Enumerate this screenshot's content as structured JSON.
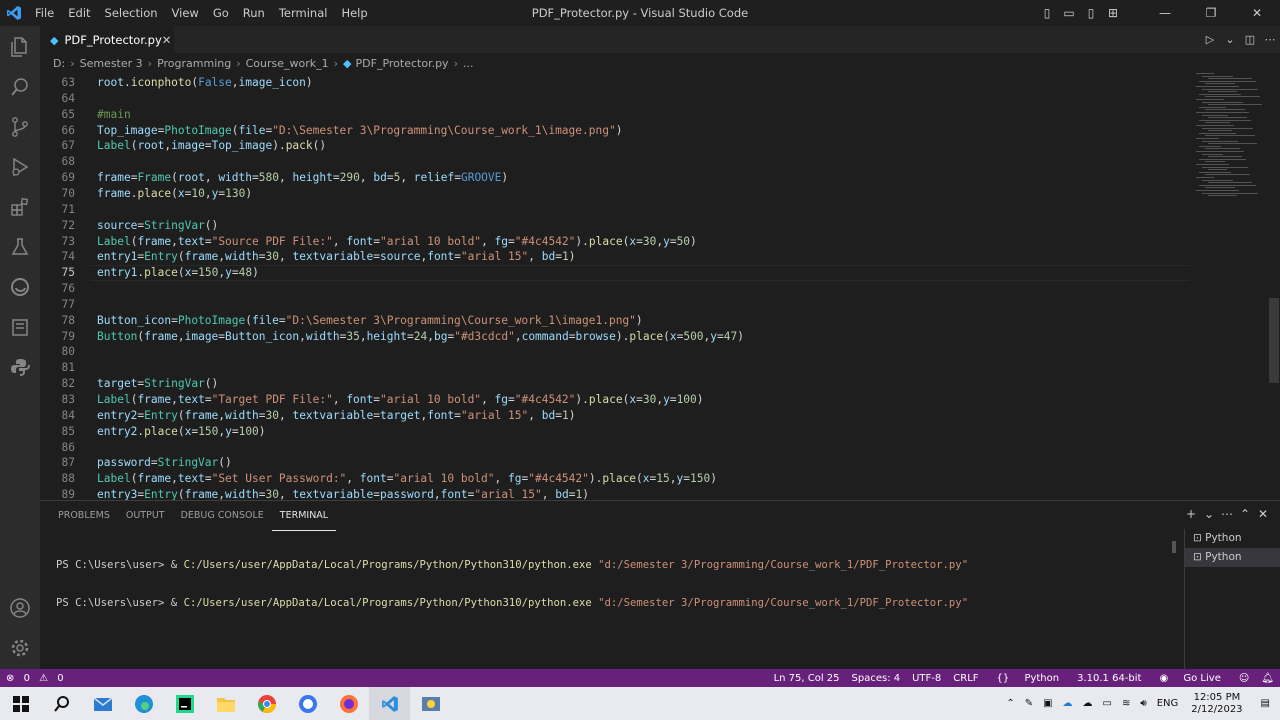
{
  "window": {
    "title": "PDF_Protector.py - Visual Studio Code",
    "menus": [
      "File",
      "Edit",
      "Selection",
      "View",
      "Go",
      "Run",
      "Terminal",
      "Help"
    ]
  },
  "tab": {
    "name": "PDF_Protector.py",
    "close": "✕"
  },
  "breadcrumb": [
    "D:",
    "Semester 3",
    "Programming",
    "Course_work_1",
    "PDF_Protector.py",
    "..."
  ],
  "editor": {
    "line_numbers": [
      "63",
      "64",
      "65",
      "66",
      "67",
      "68",
      "69",
      "70",
      "71",
      "72",
      "73",
      "74",
      "75",
      "76",
      "77",
      "78",
      "79",
      "80",
      "81",
      "82",
      "83",
      "84",
      "85",
      "86",
      "87",
      "88",
      "89"
    ],
    "current_line": "75",
    "lines": [
      [
        [
          "root",
          "v"
        ],
        [
          ".",
          ""
        ],
        [
          "iconphoto",
          "fn"
        ],
        [
          "(",
          ""
        ],
        [
          "False",
          "k"
        ],
        [
          ",",
          ""
        ],
        [
          "image_icon",
          "v"
        ],
        [
          ")",
          ""
        ]
      ],
      [],
      [
        [
          "#main",
          "c"
        ]
      ],
      [
        [
          "Top_image",
          "v"
        ],
        [
          "=",
          ""
        ],
        [
          "PhotoImage",
          "cls"
        ],
        [
          "(",
          ""
        ],
        [
          "file",
          "v"
        ],
        [
          "=",
          ""
        ],
        [
          "\"D:\\Semester 3\\Programming\\Course_work_1\\image.png\"",
          "s"
        ],
        [
          ")",
          ""
        ]
      ],
      [
        [
          "Label",
          "cls"
        ],
        [
          "(",
          ""
        ],
        [
          "root",
          "v"
        ],
        [
          ",",
          ""
        ],
        [
          "image",
          "v"
        ],
        [
          "=",
          ""
        ],
        [
          "Top_image",
          "v"
        ],
        [
          ").",
          ""
        ],
        [
          "pack",
          "fn"
        ],
        [
          "()",
          ""
        ]
      ],
      [],
      [
        [
          "frame",
          "v"
        ],
        [
          "=",
          ""
        ],
        [
          "Frame",
          "cls"
        ],
        [
          "(",
          ""
        ],
        [
          "root",
          "v"
        ],
        [
          ", ",
          ""
        ],
        [
          "width",
          "v"
        ],
        [
          "=",
          ""
        ],
        [
          "580",
          "n"
        ],
        [
          ", ",
          ""
        ],
        [
          "height",
          "v"
        ],
        [
          "=",
          ""
        ],
        [
          "290",
          "n"
        ],
        [
          ", ",
          ""
        ],
        [
          "bd",
          "v"
        ],
        [
          "=",
          ""
        ],
        [
          "5",
          "n"
        ],
        [
          ", ",
          ""
        ],
        [
          "relief",
          "v"
        ],
        [
          "=",
          ""
        ],
        [
          "GROOVE",
          "k"
        ],
        [
          ")",
          ""
        ]
      ],
      [
        [
          "frame",
          "v"
        ],
        [
          ".",
          ""
        ],
        [
          "place",
          "fn"
        ],
        [
          "(",
          ""
        ],
        [
          "x",
          "v"
        ],
        [
          "=",
          ""
        ],
        [
          "10",
          "n"
        ],
        [
          ",",
          ""
        ],
        [
          "y",
          "v"
        ],
        [
          "=",
          ""
        ],
        [
          "130",
          "n"
        ],
        [
          ")",
          ""
        ]
      ],
      [],
      [
        [
          "source",
          "v"
        ],
        [
          "=",
          ""
        ],
        [
          "StringVar",
          "cls"
        ],
        [
          "()",
          ""
        ]
      ],
      [
        [
          "Label",
          "cls"
        ],
        [
          "(",
          ""
        ],
        [
          "frame",
          "v"
        ],
        [
          ",",
          ""
        ],
        [
          "text",
          "v"
        ],
        [
          "=",
          ""
        ],
        [
          "\"Source PDF File:\"",
          "s"
        ],
        [
          ", ",
          ""
        ],
        [
          "font",
          "v"
        ],
        [
          "=",
          ""
        ],
        [
          "\"arial 10 bold\"",
          "s"
        ],
        [
          ", ",
          ""
        ],
        [
          "fg",
          "v"
        ],
        [
          "=",
          ""
        ],
        [
          "\"#4c4542\"",
          "s"
        ],
        [
          ").",
          ""
        ],
        [
          "place",
          "fn"
        ],
        [
          "(",
          ""
        ],
        [
          "x",
          "v"
        ],
        [
          "=",
          ""
        ],
        [
          "30",
          "n"
        ],
        [
          ",",
          ""
        ],
        [
          "y",
          "v"
        ],
        [
          "=",
          ""
        ],
        [
          "50",
          "n"
        ],
        [
          ")",
          ""
        ]
      ],
      [
        [
          "entry1",
          "v"
        ],
        [
          "=",
          ""
        ],
        [
          "Entry",
          "cls"
        ],
        [
          "(",
          ""
        ],
        [
          "frame",
          "v"
        ],
        [
          ",",
          ""
        ],
        [
          "width",
          "v"
        ],
        [
          "=",
          ""
        ],
        [
          "30",
          "n"
        ],
        [
          ", ",
          ""
        ],
        [
          "textvariable",
          "v"
        ],
        [
          "=",
          ""
        ],
        [
          "source",
          "v"
        ],
        [
          ",",
          ""
        ],
        [
          "font",
          "v"
        ],
        [
          "=",
          ""
        ],
        [
          "\"arial 15\"",
          "s"
        ],
        [
          ", ",
          ""
        ],
        [
          "bd",
          "v"
        ],
        [
          "=",
          ""
        ],
        [
          "1",
          "n"
        ],
        [
          ")",
          ""
        ]
      ],
      [
        [
          "entry1",
          "v"
        ],
        [
          ".",
          ""
        ],
        [
          "place",
          "fn"
        ],
        [
          "(",
          ""
        ],
        [
          "x",
          "v"
        ],
        [
          "=",
          ""
        ],
        [
          "150",
          "n"
        ],
        [
          ",",
          ""
        ],
        [
          "y",
          "v"
        ],
        [
          "=",
          ""
        ],
        [
          "48",
          "n"
        ],
        [
          ")",
          ""
        ]
      ],
      [],
      [],
      [
        [
          "Button_icon",
          "v"
        ],
        [
          "=",
          ""
        ],
        [
          "PhotoImage",
          "cls"
        ],
        [
          "(",
          ""
        ],
        [
          "file",
          "v"
        ],
        [
          "=",
          ""
        ],
        [
          "\"D:\\Semester 3\\Programming\\Course_work_1\\image1.png\"",
          "s"
        ],
        [
          ")",
          ""
        ]
      ],
      [
        [
          "Button",
          "cls"
        ],
        [
          "(",
          ""
        ],
        [
          "frame",
          "v"
        ],
        [
          ",",
          ""
        ],
        [
          "image",
          "v"
        ],
        [
          "=",
          ""
        ],
        [
          "Button_icon",
          "v"
        ],
        [
          ",",
          ""
        ],
        [
          "width",
          "v"
        ],
        [
          "=",
          ""
        ],
        [
          "35",
          "n"
        ],
        [
          ",",
          ""
        ],
        [
          "height",
          "v"
        ],
        [
          "=",
          ""
        ],
        [
          "24",
          "n"
        ],
        [
          ",",
          ""
        ],
        [
          "bg",
          "v"
        ],
        [
          "=",
          ""
        ],
        [
          "\"#d3cdcd\"",
          "s"
        ],
        [
          ",",
          ""
        ],
        [
          "command",
          "v"
        ],
        [
          "=",
          ""
        ],
        [
          "browse",
          "v"
        ],
        [
          ").",
          ""
        ],
        [
          "place",
          "fn"
        ],
        [
          "(",
          ""
        ],
        [
          "x",
          "v"
        ],
        [
          "=",
          ""
        ],
        [
          "500",
          "n"
        ],
        [
          ",",
          ""
        ],
        [
          "y",
          "v"
        ],
        [
          "=",
          ""
        ],
        [
          "47",
          "n"
        ],
        [
          ")",
          ""
        ]
      ],
      [],
      [],
      [
        [
          "target",
          "v"
        ],
        [
          "=",
          ""
        ],
        [
          "StringVar",
          "cls"
        ],
        [
          "()",
          ""
        ]
      ],
      [
        [
          "Label",
          "cls"
        ],
        [
          "(",
          ""
        ],
        [
          "frame",
          "v"
        ],
        [
          ",",
          ""
        ],
        [
          "text",
          "v"
        ],
        [
          "=",
          ""
        ],
        [
          "\"Target PDF File:\"",
          "s"
        ],
        [
          ", ",
          ""
        ],
        [
          "font",
          "v"
        ],
        [
          "=",
          ""
        ],
        [
          "\"arial 10 bold\"",
          "s"
        ],
        [
          ", ",
          ""
        ],
        [
          "fg",
          "v"
        ],
        [
          "=",
          ""
        ],
        [
          "\"#4c4542\"",
          "s"
        ],
        [
          ").",
          ""
        ],
        [
          "place",
          "fn"
        ],
        [
          "(",
          ""
        ],
        [
          "x",
          "v"
        ],
        [
          "=",
          ""
        ],
        [
          "30",
          "n"
        ],
        [
          ",",
          ""
        ],
        [
          "y",
          "v"
        ],
        [
          "=",
          ""
        ],
        [
          "100",
          "n"
        ],
        [
          ")",
          ""
        ]
      ],
      [
        [
          "entry2",
          "v"
        ],
        [
          "=",
          ""
        ],
        [
          "Entry",
          "cls"
        ],
        [
          "(",
          ""
        ],
        [
          "frame",
          "v"
        ],
        [
          ",",
          ""
        ],
        [
          "width",
          "v"
        ],
        [
          "=",
          ""
        ],
        [
          "30",
          "n"
        ],
        [
          ", ",
          ""
        ],
        [
          "textvariable",
          "v"
        ],
        [
          "=",
          ""
        ],
        [
          "target",
          "v"
        ],
        [
          ",",
          ""
        ],
        [
          "font",
          "v"
        ],
        [
          "=",
          ""
        ],
        [
          "\"arial 15\"",
          "s"
        ],
        [
          ", ",
          ""
        ],
        [
          "bd",
          "v"
        ],
        [
          "=",
          ""
        ],
        [
          "1",
          "n"
        ],
        [
          ")",
          ""
        ]
      ],
      [
        [
          "entry2",
          "v"
        ],
        [
          ".",
          ""
        ],
        [
          "place",
          "fn"
        ],
        [
          "(",
          ""
        ],
        [
          "x",
          "v"
        ],
        [
          "=",
          ""
        ],
        [
          "150",
          "n"
        ],
        [
          ",",
          ""
        ],
        [
          "y",
          "v"
        ],
        [
          "=",
          ""
        ],
        [
          "100",
          "n"
        ],
        [
          ")",
          ""
        ]
      ],
      [],
      [
        [
          "password",
          "v"
        ],
        [
          "=",
          ""
        ],
        [
          "StringVar",
          "cls"
        ],
        [
          "()",
          ""
        ]
      ],
      [
        [
          "Label",
          "cls"
        ],
        [
          "(",
          ""
        ],
        [
          "frame",
          "v"
        ],
        [
          ",",
          ""
        ],
        [
          "text",
          "v"
        ],
        [
          "=",
          ""
        ],
        [
          "\"Set User Password:\"",
          "s"
        ],
        [
          ", ",
          ""
        ],
        [
          "font",
          "v"
        ],
        [
          "=",
          ""
        ],
        [
          "\"arial 10 bold\"",
          "s"
        ],
        [
          ", ",
          ""
        ],
        [
          "fg",
          "v"
        ],
        [
          "=",
          ""
        ],
        [
          "\"#4c4542\"",
          "s"
        ],
        [
          ").",
          ""
        ],
        [
          "place",
          "fn"
        ],
        [
          "(",
          ""
        ],
        [
          "x",
          "v"
        ],
        [
          "=",
          ""
        ],
        [
          "15",
          "n"
        ],
        [
          ",",
          ""
        ],
        [
          "y",
          "v"
        ],
        [
          "=",
          ""
        ],
        [
          "150",
          "n"
        ],
        [
          ")",
          ""
        ]
      ],
      [
        [
          "entry3",
          "v"
        ],
        [
          "=",
          ""
        ],
        [
          "Entry",
          "cls"
        ],
        [
          "(",
          ""
        ],
        [
          "frame",
          "v"
        ],
        [
          ",",
          ""
        ],
        [
          "width",
          "v"
        ],
        [
          "=",
          ""
        ],
        [
          "30",
          "n"
        ],
        [
          ", ",
          ""
        ],
        [
          "textvariable",
          "v"
        ],
        [
          "=",
          ""
        ],
        [
          "password",
          "v"
        ],
        [
          ",",
          ""
        ],
        [
          "font",
          "v"
        ],
        [
          "=",
          ""
        ],
        [
          "\"arial 15\"",
          "s"
        ],
        [
          ", ",
          ""
        ],
        [
          "bd",
          "v"
        ],
        [
          "=",
          ""
        ],
        [
          "1",
          "n"
        ],
        [
          ")",
          ""
        ]
      ]
    ]
  },
  "panel": {
    "tabs": [
      "PROBLEMS",
      "OUTPUT",
      "DEBUG CONSOLE",
      "TERMINAL"
    ],
    "active_tab": "TERMINAL",
    "terminal_lines": [
      {
        "prompt": "PS C:\\Users\\user> & ",
        "exe": "C:/Users/user/AppData/Local/Programs/Python/Python310/python.exe",
        "arg": " \"d:/Semester 3/Programming/Course_work_1/PDF_Protector.py\""
      },
      {
        "prompt": "PS C:\\Users\\user> & ",
        "exe": "C:/Users/user/AppData/Local/Programs/Python/Python310/python.exe",
        "arg": " \"d:/Semester 3/Programming/Course_work_1/PDF_Protector.py\""
      }
    ],
    "terminals": [
      "Python",
      "Python"
    ]
  },
  "status": {
    "errors": "0",
    "warnings": "0",
    "position": "Ln 75, Col 25",
    "spaces": "Spaces: 4",
    "encoding": "UTF-8",
    "eol": "CRLF",
    "language": "Python",
    "interpreter": "3.10.1 64-bit",
    "golive": "Go Live"
  },
  "taskbar": {
    "time": "12:05 PM",
    "date": "2/12/2023",
    "lang": "ENG"
  },
  "colors": {
    "statusbar": "#68217a",
    "accent": "#3b9cf0"
  }
}
